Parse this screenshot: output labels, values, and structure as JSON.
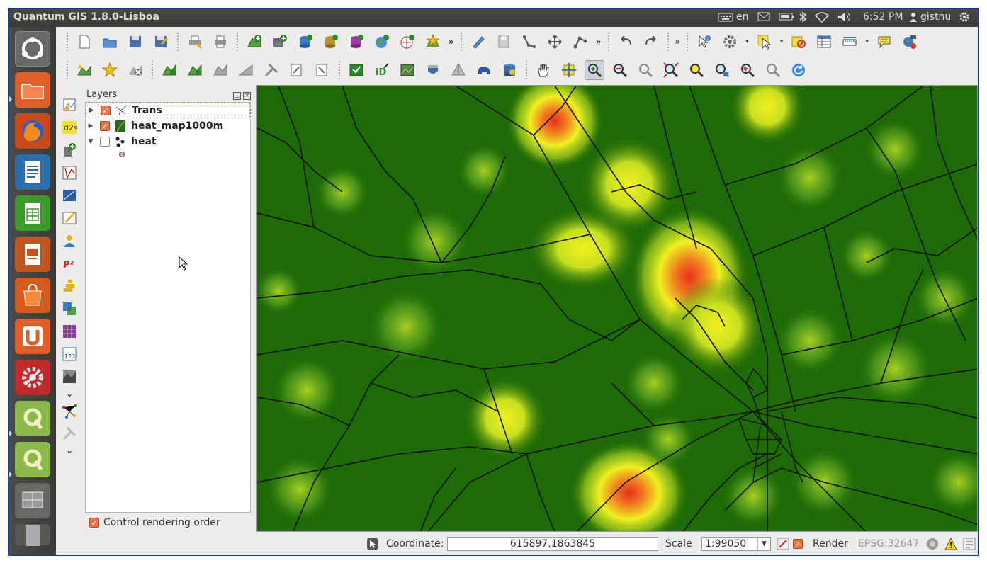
{
  "window": {
    "title": "Quantum GIS 1.8.0-Lisboa"
  },
  "indicators": {
    "keyboard": "en",
    "time": "6:52 PM",
    "user": "gistnu"
  },
  "layers_panel": {
    "title": "Layers",
    "items": [
      {
        "name": "Trans",
        "checked": true,
        "expanded": false
      },
      {
        "name": "heat_map1000m",
        "checked": true,
        "expanded": false
      },
      {
        "name": "heat",
        "checked": false,
        "expanded": true
      }
    ],
    "control_rendering_label": "Control rendering order"
  },
  "statusbar": {
    "coordinate_label": "Coordinate:",
    "coordinate_value": "615897,1863845",
    "scale_label": "Scale",
    "scale_value": "1:99050",
    "render_label": "Render",
    "crs": "EPSG:32647"
  },
  "colors": {
    "accent": "#e8744a",
    "map_bg": "#1d6a06",
    "launcher": "#3d3b37"
  }
}
